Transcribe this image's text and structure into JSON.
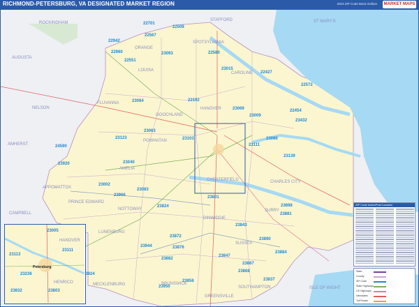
{
  "header": {
    "title": "RICHMOND-PETERSBURG, VA DESIGNATED MARKET REGION",
    "edition": "2023 ZIP Code Basic Edition",
    "logo": "MARKET MAPS"
  },
  "colors": {
    "header_bg": "#2b5ba8",
    "land": "#fbf6cf",
    "outside": "#eef0f3",
    "water": "#a6d9f3",
    "zip_label": "#1e88d6",
    "county_label": "#8a8fc2"
  },
  "counties": [
    {
      "name": "STAFFORD"
    },
    {
      "name": "ST MARY'S"
    },
    {
      "name": "ROCKINGHAM"
    },
    {
      "name": "ORANGE"
    },
    {
      "name": "SPOTSYLVANIA"
    },
    {
      "name": "LOUISA"
    },
    {
      "name": "CAROLINE"
    },
    {
      "name": "AUGUSTA"
    },
    {
      "name": "FLUVANNA"
    },
    {
      "name": "HANOVER"
    },
    {
      "name": "NELSON"
    },
    {
      "name": "GOOCHLAND"
    },
    {
      "name": "POWHATAN"
    },
    {
      "name": "AMHERST"
    },
    {
      "name": "AMELIA"
    },
    {
      "name": "CHESTERFIELD"
    },
    {
      "name": "CHARLES CITY"
    },
    {
      "name": "APPOMATTOX"
    },
    {
      "name": "PRINCE EDWARD"
    },
    {
      "name": "NOTTOWAY"
    },
    {
      "name": "CAMPBELL"
    },
    {
      "name": "DINWIDDIE"
    },
    {
      "name": "SURRY"
    },
    {
      "name": "LUNENBURG"
    },
    {
      "name": "SUSSEX"
    },
    {
      "name": "BRUNSWICK"
    },
    {
      "name": "MECKLENBURG"
    },
    {
      "name": "SOUTHAMPTON"
    },
    {
      "name": "GREENSVILLE"
    },
    {
      "name": "ISLE OF WIGHT"
    }
  ],
  "zips": [
    {
      "code": "22701"
    },
    {
      "code": "22508"
    },
    {
      "code": "22567"
    },
    {
      "code": "22942"
    },
    {
      "code": "22960"
    },
    {
      "code": "22551"
    },
    {
      "code": "23093"
    },
    {
      "code": "22580"
    },
    {
      "code": "23015"
    },
    {
      "code": "22427"
    },
    {
      "code": "22572"
    },
    {
      "code": "23084"
    },
    {
      "code": "23192"
    },
    {
      "code": "23069"
    },
    {
      "code": "23009"
    },
    {
      "code": "22454"
    },
    {
      "code": "23432"
    },
    {
      "code": "23063"
    },
    {
      "code": "23103"
    },
    {
      "code": "23111"
    },
    {
      "code": "23086"
    },
    {
      "code": "23139"
    },
    {
      "code": "23123"
    },
    {
      "code": "24590"
    },
    {
      "code": "23040"
    },
    {
      "code": "23920"
    },
    {
      "code": "23002"
    },
    {
      "code": "23083"
    },
    {
      "code": "23966"
    },
    {
      "code": "23824"
    },
    {
      "code": "23872"
    },
    {
      "code": "23843"
    },
    {
      "code": "23890"
    },
    {
      "code": "23876"
    },
    {
      "code": "23882"
    },
    {
      "code": "23847"
    },
    {
      "code": "23837"
    },
    {
      "code": "23884"
    },
    {
      "code": "23867"
    },
    {
      "code": "23868"
    },
    {
      "code": "23856"
    },
    {
      "code": "23898"
    },
    {
      "code": "23881"
    },
    {
      "code": "23923"
    },
    {
      "code": "23924"
    },
    {
      "code": "23944"
    },
    {
      "code": "23950"
    },
    {
      "code": "23801"
    }
  ],
  "inset": {
    "zips": [
      {
        "code": "23005"
      },
      {
        "code": "23111"
      },
      {
        "code": "23113"
      },
      {
        "code": "23236"
      },
      {
        "code": "23832"
      },
      {
        "code": "23803"
      }
    ],
    "counties": [
      {
        "name": "HANOVER"
      },
      {
        "name": "HENRICO"
      }
    ],
    "city": "Petersburg"
  },
  "zip_index": {
    "title": "ZIP Code Index/Post Location"
  },
  "legend": {
    "items": [
      {
        "label": "State"
      },
      {
        "label": "County"
      },
      {
        "label": "ZIP Code"
      },
      {
        "label": "State Highways"
      },
      {
        "label": "US Highways"
      },
      {
        "label": "Interstates"
      },
      {
        "label": "Toll Roads"
      }
    ]
  }
}
